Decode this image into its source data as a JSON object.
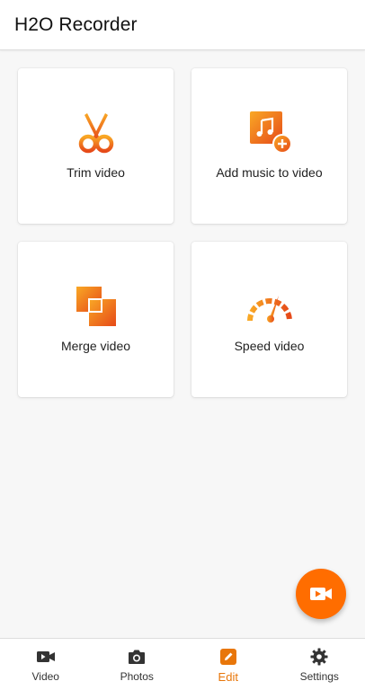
{
  "app_bar": {
    "title": "H2O Recorder"
  },
  "cards": [
    {
      "label": "Trim video",
      "icon": "scissors-icon"
    },
    {
      "label": "Add music to video",
      "icon": "add-music-icon"
    },
    {
      "label": "Merge video",
      "icon": "merge-icon"
    },
    {
      "label": "Speed video",
      "icon": "speedometer-icon"
    }
  ],
  "fab": {
    "icon": "video-camera-icon"
  },
  "bottom_nav": {
    "items": [
      {
        "label": "Video",
        "icon": "video-camera-icon",
        "active": false
      },
      {
        "label": "Photos",
        "icon": "camera-icon",
        "active": false
      },
      {
        "label": "Edit",
        "icon": "pencil-icon",
        "active": true
      },
      {
        "label": "Settings",
        "icon": "gear-icon",
        "active": false
      }
    ]
  },
  "colors": {
    "accent": "#ff6d00",
    "active_nav": "#e8760a",
    "gradient_start": "#f9a825",
    "gradient_end": "#e64a19"
  }
}
